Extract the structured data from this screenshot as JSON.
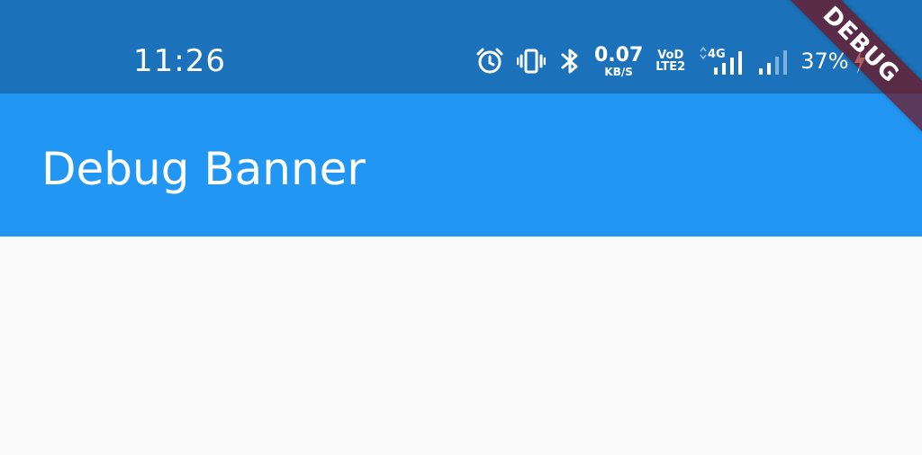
{
  "status_bar": {
    "time": "11:26",
    "net_speed_value": "0.07",
    "net_speed_unit": "KB/S",
    "volte_top": "VoD",
    "volte_bottom": "LTE2",
    "network_type": "4G",
    "battery_percent": "37%",
    "background_color": "#1b72ba",
    "icons": [
      "alarm-icon",
      "vibrate-icon",
      "bluetooth-icon",
      "signal-icon",
      "signal-weak-icon",
      "charging-icon"
    ]
  },
  "app_bar": {
    "title": "Debug Banner",
    "background_color": "#2196f3"
  },
  "debug_banner": {
    "label": "DEBUG",
    "color": "#800000"
  }
}
